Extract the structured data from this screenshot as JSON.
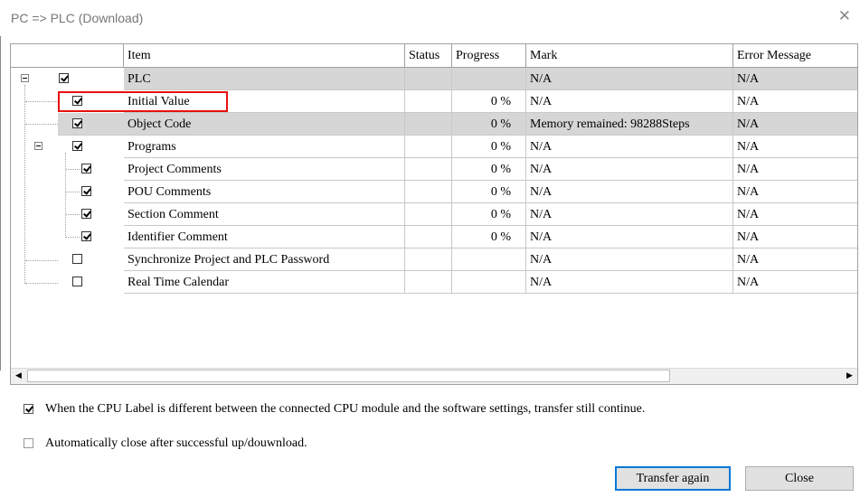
{
  "window": {
    "title": "PC => PLC (Download)",
    "close_glyph": "✕"
  },
  "columns": {
    "item": "Item",
    "status": "Status",
    "progress": "Progress",
    "mark": "Mark",
    "error": "Error Message"
  },
  "rows": [
    {
      "item": "PLC",
      "checked": true,
      "status": "",
      "progress": "",
      "mark": "N/A",
      "error": "N/A"
    },
    {
      "item": "Initial Value",
      "checked": true,
      "status": "",
      "progress": "0 %",
      "mark": "N/A",
      "error": "N/A"
    },
    {
      "item": "Object Code",
      "checked": true,
      "status": "",
      "progress": "0 %",
      "mark": "Memory remained: 98288Steps",
      "error": "N/A"
    },
    {
      "item": "Programs",
      "checked": true,
      "status": "",
      "progress": "0 %",
      "mark": "N/A",
      "error": "N/A"
    },
    {
      "item": "Project Comments",
      "checked": true,
      "status": "",
      "progress": "0 %",
      "mark": "N/A",
      "error": "N/A"
    },
    {
      "item": "POU Comments",
      "checked": true,
      "status": "",
      "progress": "0 %",
      "mark": "N/A",
      "error": "N/A"
    },
    {
      "item": "Section Comment",
      "checked": true,
      "status": "",
      "progress": "0 %",
      "mark": "N/A",
      "error": "N/A"
    },
    {
      "item": "Identifier Comment",
      "checked": true,
      "status": "",
      "progress": "0 %",
      "mark": "N/A",
      "error": "N/A"
    },
    {
      "item": "Synchronize Project and PLC Password",
      "checked": false,
      "status": "",
      "progress": "",
      "mark": "N/A",
      "error": "N/A"
    },
    {
      "item": "Real Time Calendar",
      "checked": false,
      "status": "",
      "progress": "",
      "mark": "N/A",
      "error": "N/A"
    }
  ],
  "options": {
    "cpu_label": {
      "label": "When the CPU Label is different between the connected CPU module and the software settings, transfer still continue.",
      "checked": true
    },
    "auto_close": {
      "label": "Automatically close after successful up/douwnload.",
      "checked": false
    }
  },
  "buttons": {
    "transfer_again": "Transfer again",
    "close": "Close"
  },
  "scrollbar": {
    "left_arrow": "◀",
    "right_arrow": "▶"
  },
  "colors": {
    "highlight_border": "#e81010",
    "gray_row": "#d6d6d6"
  }
}
